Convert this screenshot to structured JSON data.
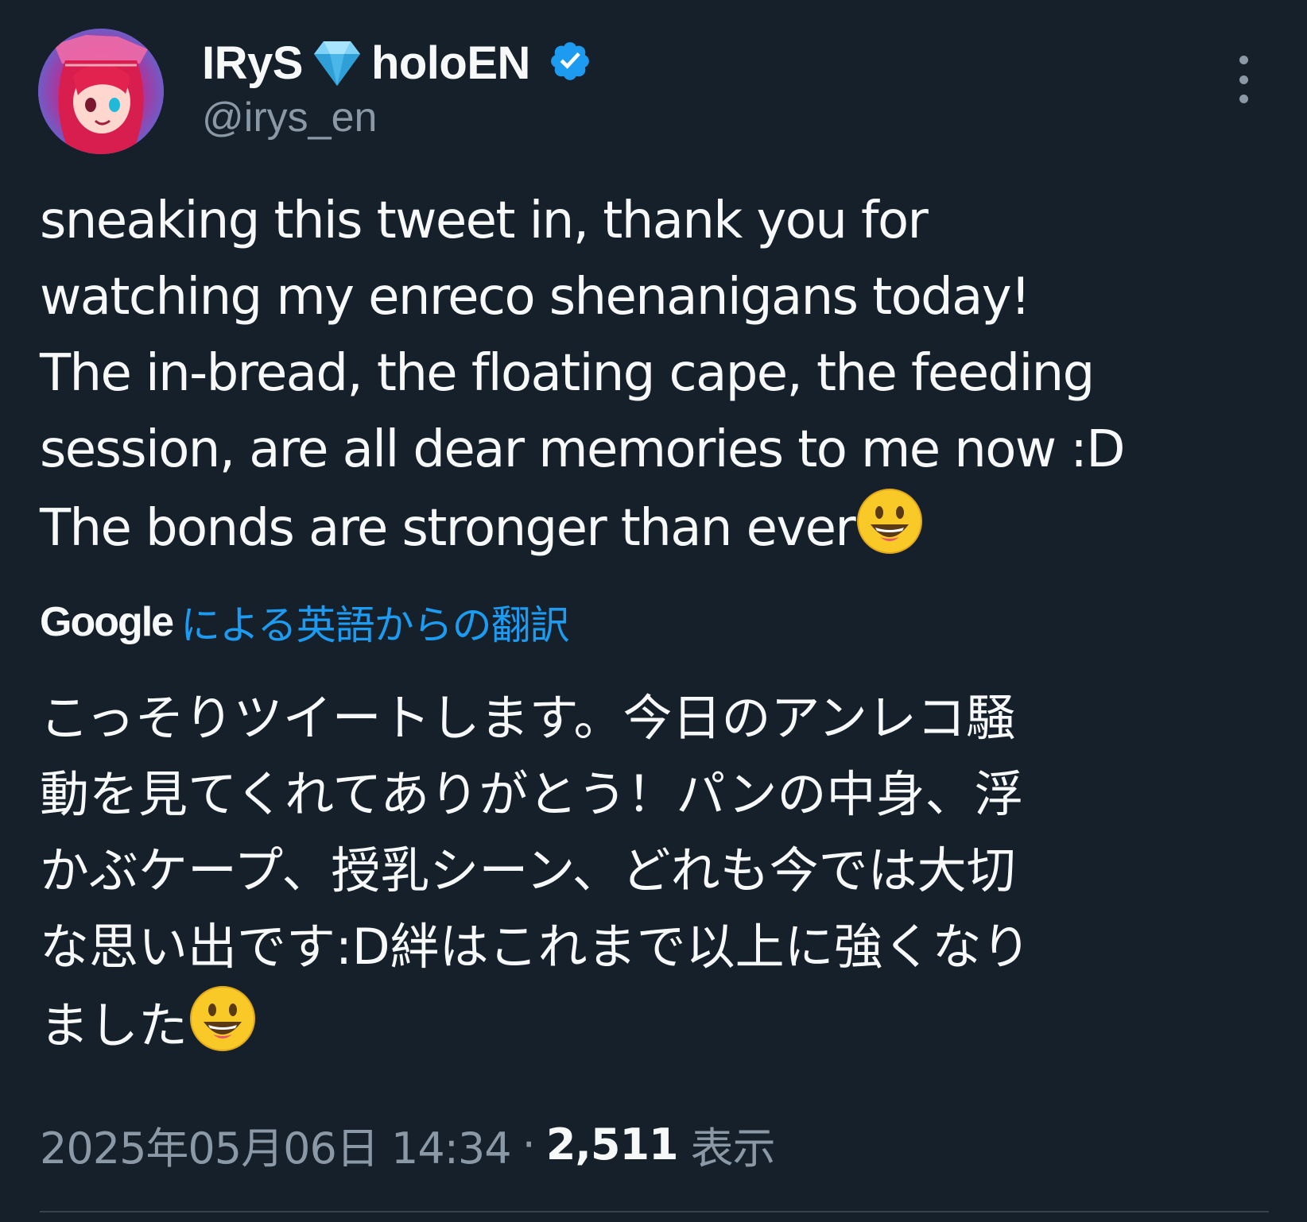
{
  "author": {
    "display_name_part1": "IRyS",
    "display_name_part2": "holoEN",
    "name_icon": "gem-icon",
    "verified_icon": "verified-badge-icon",
    "handle": "@irys_en",
    "avatar_icon": "avatar-image"
  },
  "more_icon": "more-options-icon",
  "tweet": {
    "lines": [
      "sneaking this tweet in, thank you for",
      "watching my enreco shenanigans today!",
      "The in-bread, the floating cape, the feeding",
      "session, are all dear memories to me now :D",
      "The bonds are stronger than ever"
    ],
    "trailing_emoji": "smiley-face-emoji"
  },
  "translation": {
    "provider": "Google",
    "label": "による英語からの翻訳",
    "lines": [
      "こっそりツイートします。今日のアンレコ騒",
      "動を見てくれてありがとう！パンの中身、浮",
      "かぶケープ、授乳シーン、どれも今では大切",
      "な思い出です:D絆はこれまで以上に強くなり",
      "ました"
    ],
    "trailing_emoji": "smiley-face-emoji"
  },
  "meta": {
    "timestamp": "2025年05月06日 14:34",
    "separator": "·",
    "views_count": "2,511",
    "views_label": "表示"
  },
  "colors": {
    "background": "#15202b",
    "text_primary": "#f7f9f9",
    "text_secondary": "#8b98a5",
    "link": "#1d9bf0",
    "verified": "#1d9bf0",
    "divider": "#38444d"
  }
}
